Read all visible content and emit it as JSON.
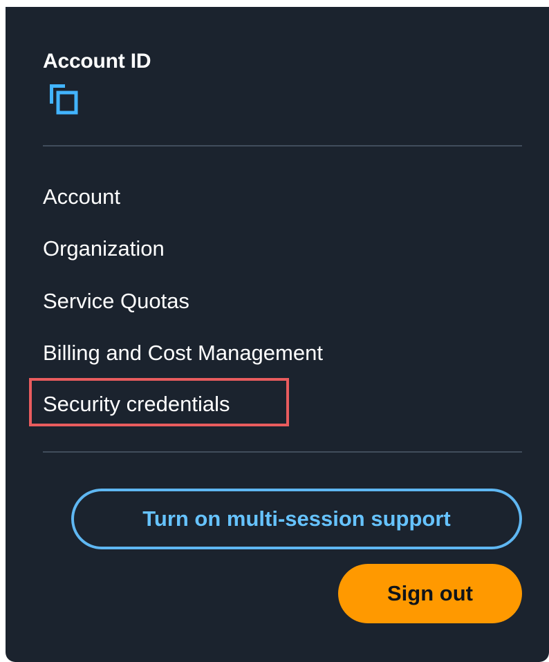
{
  "account": {
    "label": "Account ID",
    "copy_icon": "copy-icon"
  },
  "menu": {
    "items": [
      {
        "label": "Account"
      },
      {
        "label": "Organization"
      },
      {
        "label": "Service Quotas"
      },
      {
        "label": "Billing and Cost Management"
      },
      {
        "label": "Security credentials",
        "highlighted": true
      }
    ]
  },
  "actions": {
    "multi_session_label": "Turn on multi-session support",
    "sign_out_label": "Sign out"
  },
  "colors": {
    "panel_bg": "#1b232e",
    "divider": "#414d5c",
    "accent_blue": "#5fb7f2",
    "copy_icon": "#42b4ff",
    "sign_out_bg": "#ff9900",
    "highlight": "#e95c5e"
  }
}
